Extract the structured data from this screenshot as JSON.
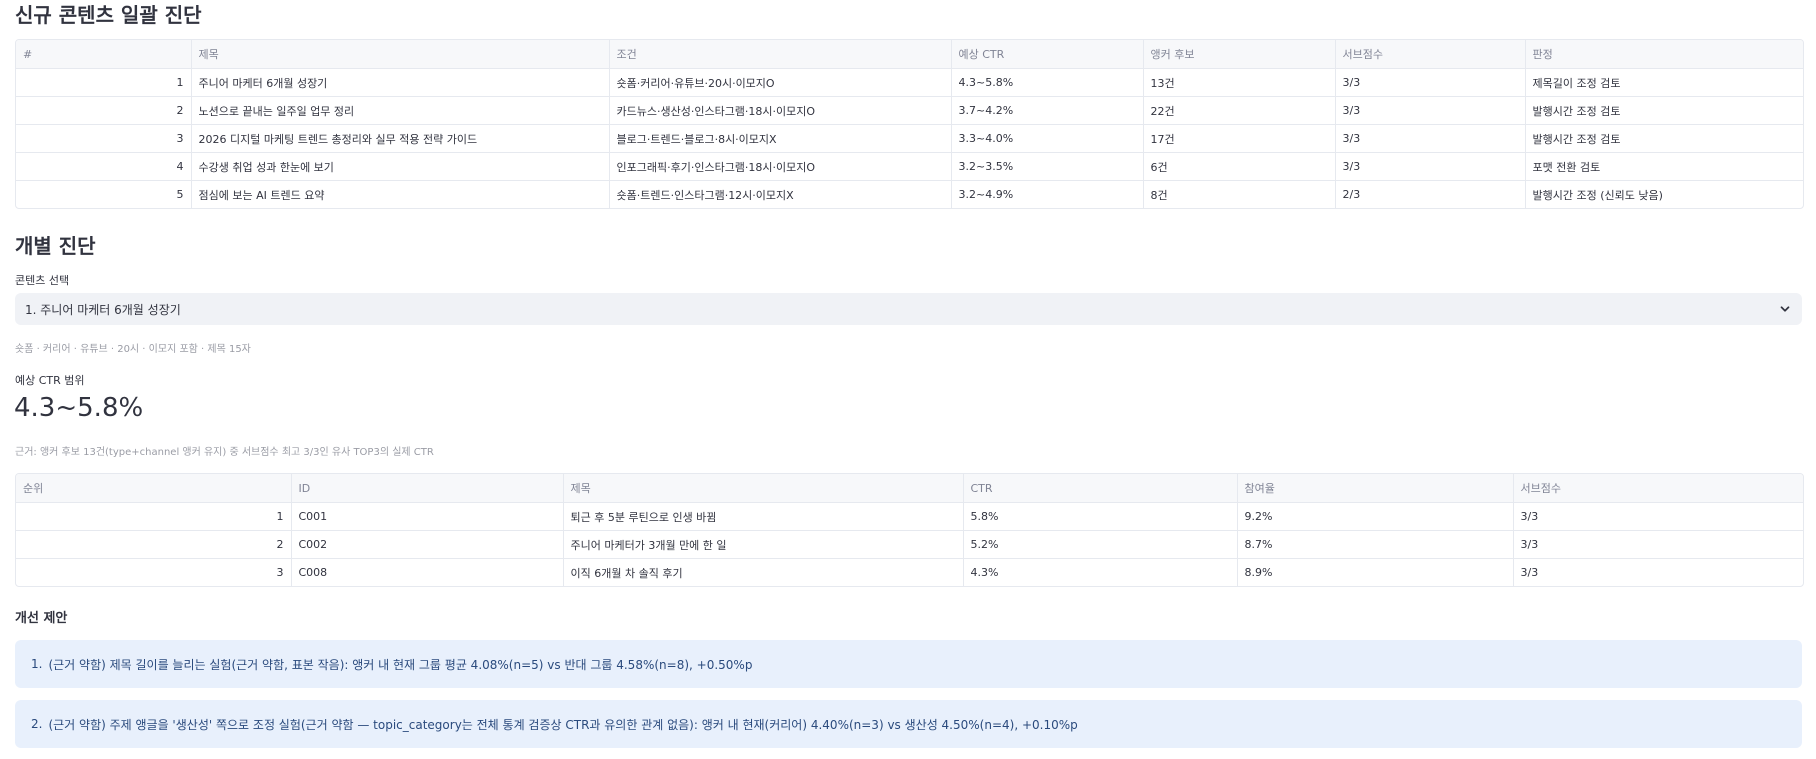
{
  "batch": {
    "title": "신규 콘텐츠 일괄 진단",
    "columns": [
      "#",
      "제목",
      "조건",
      "예상 CTR",
      "앵커 후보",
      "서브점수",
      "판정"
    ],
    "rows": [
      {
        "idx": "1",
        "title": "주니어 마케터 6개월 성장기",
        "cond": "숏폼·커리어·유튜브·20시·이모지O",
        "ctr": "4.3~5.8%",
        "anchor": "13건",
        "score": "3/3",
        "verdict": "제목길이 조정 검토"
      },
      {
        "idx": "2",
        "title": "노션으로 끝내는 일주일 업무 정리",
        "cond": "카드뉴스·생산성·인스타그램·18시·이모지O",
        "ctr": "3.7~4.2%",
        "anchor": "22건",
        "score": "3/3",
        "verdict": "발행시간 조정 검토"
      },
      {
        "idx": "3",
        "title": "2026 디지털 마케팅 트렌드 총정리와 실무 적용 전략 가이드",
        "cond": "블로그·트렌드·블로그·8시·이모지X",
        "ctr": "3.3~4.0%",
        "anchor": "17건",
        "score": "3/3",
        "verdict": "발행시간 조정 검토"
      },
      {
        "idx": "4",
        "title": "수강생 취업 성과 한눈에 보기",
        "cond": "인포그래픽·후기·인스타그램·18시·이모지O",
        "ctr": "3.2~3.5%",
        "anchor": "6건",
        "score": "3/3",
        "verdict": "포맷 전환 검토"
      },
      {
        "idx": "5",
        "title": "점심에 보는 AI 트렌드 요약",
        "cond": "숏폼·트렌드·인스타그램·12시·이모지X",
        "ctr": "3.2~4.9%",
        "anchor": "8건",
        "score": "2/3",
        "verdict": "발행시간 조정 (신뢰도 낮음)"
      }
    ]
  },
  "individual": {
    "title": "개별 진단",
    "select_label": "콘텐츠 선택",
    "selected": "1. 주니어 마케터 6개월 성장기",
    "caption": "숏폼 · 커리어 · 유튜브 · 20시 · 이모지 포함 · 제목 15자",
    "metric_label": "예상 CTR 범위",
    "metric_value": "4.3~5.8%",
    "basis": "근거: 앵커 후보 13건(type+channel 앵커 유지) 중 서브점수 최고 3/3인 유사 TOP3의 실제 CTR",
    "columns": [
      "순위",
      "ID",
      "제목",
      "CTR",
      "참여율",
      "서브점수"
    ],
    "rows": [
      {
        "rank": "1",
        "id": "C001",
        "title": "퇴근 후 5분 루틴으로 인생 바뀜",
        "ctr": "5.8%",
        "eng": "9.2%",
        "score": "3/3"
      },
      {
        "rank": "2",
        "id": "C002",
        "title": "주니어 마케터가 3개월 만에 한 일",
        "ctr": "5.2%",
        "eng": "8.7%",
        "score": "3/3"
      },
      {
        "rank": "3",
        "id": "C008",
        "title": "이직 6개월 차 솔직 후기",
        "ctr": "4.3%",
        "eng": "8.9%",
        "score": "3/3"
      }
    ]
  },
  "suggestions": {
    "title": "개선 제안",
    "items": [
      {
        "idx": "1.",
        "text": "(근거 약함) 제목 길이를 늘리는 실험(근거 약함, 표본 작음): 앵커 내 현재 그룹 평균 4.08%(n=5) vs 반대 그룹 4.58%(n=8), +0.50%p"
      },
      {
        "idx": "2.",
        "text": "(근거 약함) 주제 앵글을 '생산성' 쪽으로 조정 실험(근거 약함 — topic_category는 전체 통계 검증상 CTR과 유의한 관계 없음): 앵커 내 현재(커리어) 4.40%(n=3) vs 생산성 4.50%(n=4), +0.10%p"
      }
    ]
  },
  "icons": {
    "dropdown": "chevron-down-icon"
  }
}
